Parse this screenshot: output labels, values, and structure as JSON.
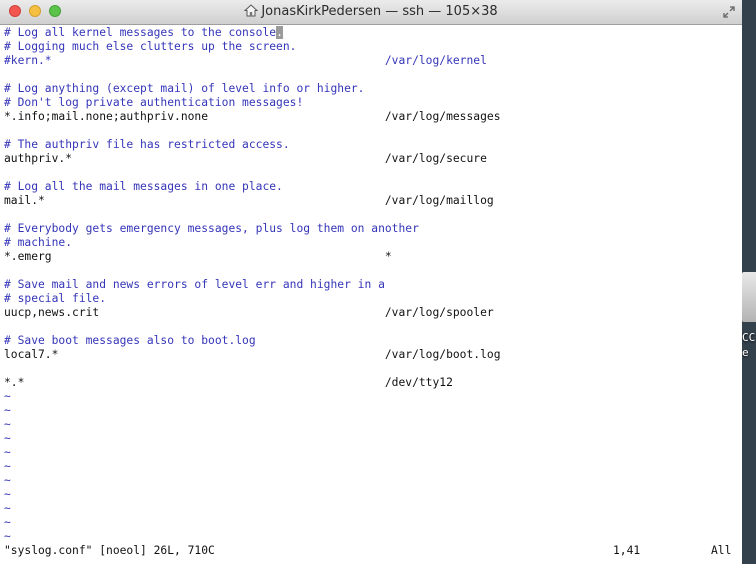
{
  "window": {
    "title": "JonasKirkPedersen — ssh — 105×38",
    "title_icon": "home-folder-icon",
    "buttons": [
      "close",
      "minimize",
      "zoom"
    ]
  },
  "editor": {
    "lines": [
      {
        "text": "# Log all kernel messages to the console",
        "cursor": ".",
        "kind": "comment"
      },
      {
        "text": "# Logging much else clutters up the screen.",
        "kind": "comment"
      },
      {
        "text": "#kern.*                                                 /var/log/kernel",
        "kind": "comment"
      },
      {
        "text": "",
        "kind": "blank"
      },
      {
        "text": "# Log anything (except mail) of level info or higher.",
        "kind": "comment"
      },
      {
        "text": "# Don't log private authentication messages!",
        "kind": "comment"
      },
      {
        "text": "*.info;mail.none;authpriv.none                          /var/log/messages",
        "kind": "rule"
      },
      {
        "text": "",
        "kind": "blank"
      },
      {
        "text": "# The authpriv file has restricted access.",
        "kind": "comment"
      },
      {
        "text": "authpriv.*                                              /var/log/secure",
        "kind": "rule"
      },
      {
        "text": "",
        "kind": "blank"
      },
      {
        "text": "# Log all the mail messages in one place.",
        "kind": "comment"
      },
      {
        "text": "mail.*                                                  /var/log/maillog",
        "kind": "rule"
      },
      {
        "text": "",
        "kind": "blank"
      },
      {
        "text": "# Everybody gets emergency messages, plus log them on another",
        "kind": "comment"
      },
      {
        "text": "# machine.",
        "kind": "comment"
      },
      {
        "text": "*.emerg                                                 *",
        "kind": "rule"
      },
      {
        "text": "",
        "kind": "blank"
      },
      {
        "text": "# Save mail and news errors of level err and higher in a",
        "kind": "comment"
      },
      {
        "text": "# special file.",
        "kind": "comment"
      },
      {
        "text": "uucp,news.crit                                          /var/log/spooler",
        "kind": "rule"
      },
      {
        "text": "",
        "kind": "blank"
      },
      {
        "text": "# Save boot messages also to boot.log",
        "kind": "comment"
      },
      {
        "text": "local7.*                                                /var/log/boot.log",
        "kind": "rule"
      },
      {
        "text": "",
        "kind": "blank"
      },
      {
        "text": "*.*                                                     /dev/tty12",
        "kind": "rule"
      },
      {
        "text": "~",
        "kind": "tilde"
      },
      {
        "text": "~",
        "kind": "tilde"
      },
      {
        "text": "~",
        "kind": "tilde"
      },
      {
        "text": "~",
        "kind": "tilde"
      },
      {
        "text": "~",
        "kind": "tilde"
      },
      {
        "text": "~",
        "kind": "tilde"
      },
      {
        "text": "~",
        "kind": "tilde"
      },
      {
        "text": "~",
        "kind": "tilde"
      },
      {
        "text": "~",
        "kind": "tilde"
      },
      {
        "text": "~",
        "kind": "tilde"
      },
      {
        "text": "~",
        "kind": "tilde"
      }
    ],
    "status": {
      "file": "\"syslog.conf\" [noeol] 26L, 710C",
      "position": "1,41",
      "scroll": "All"
    }
  },
  "desktop": {
    "label": "CC\ne"
  }
}
